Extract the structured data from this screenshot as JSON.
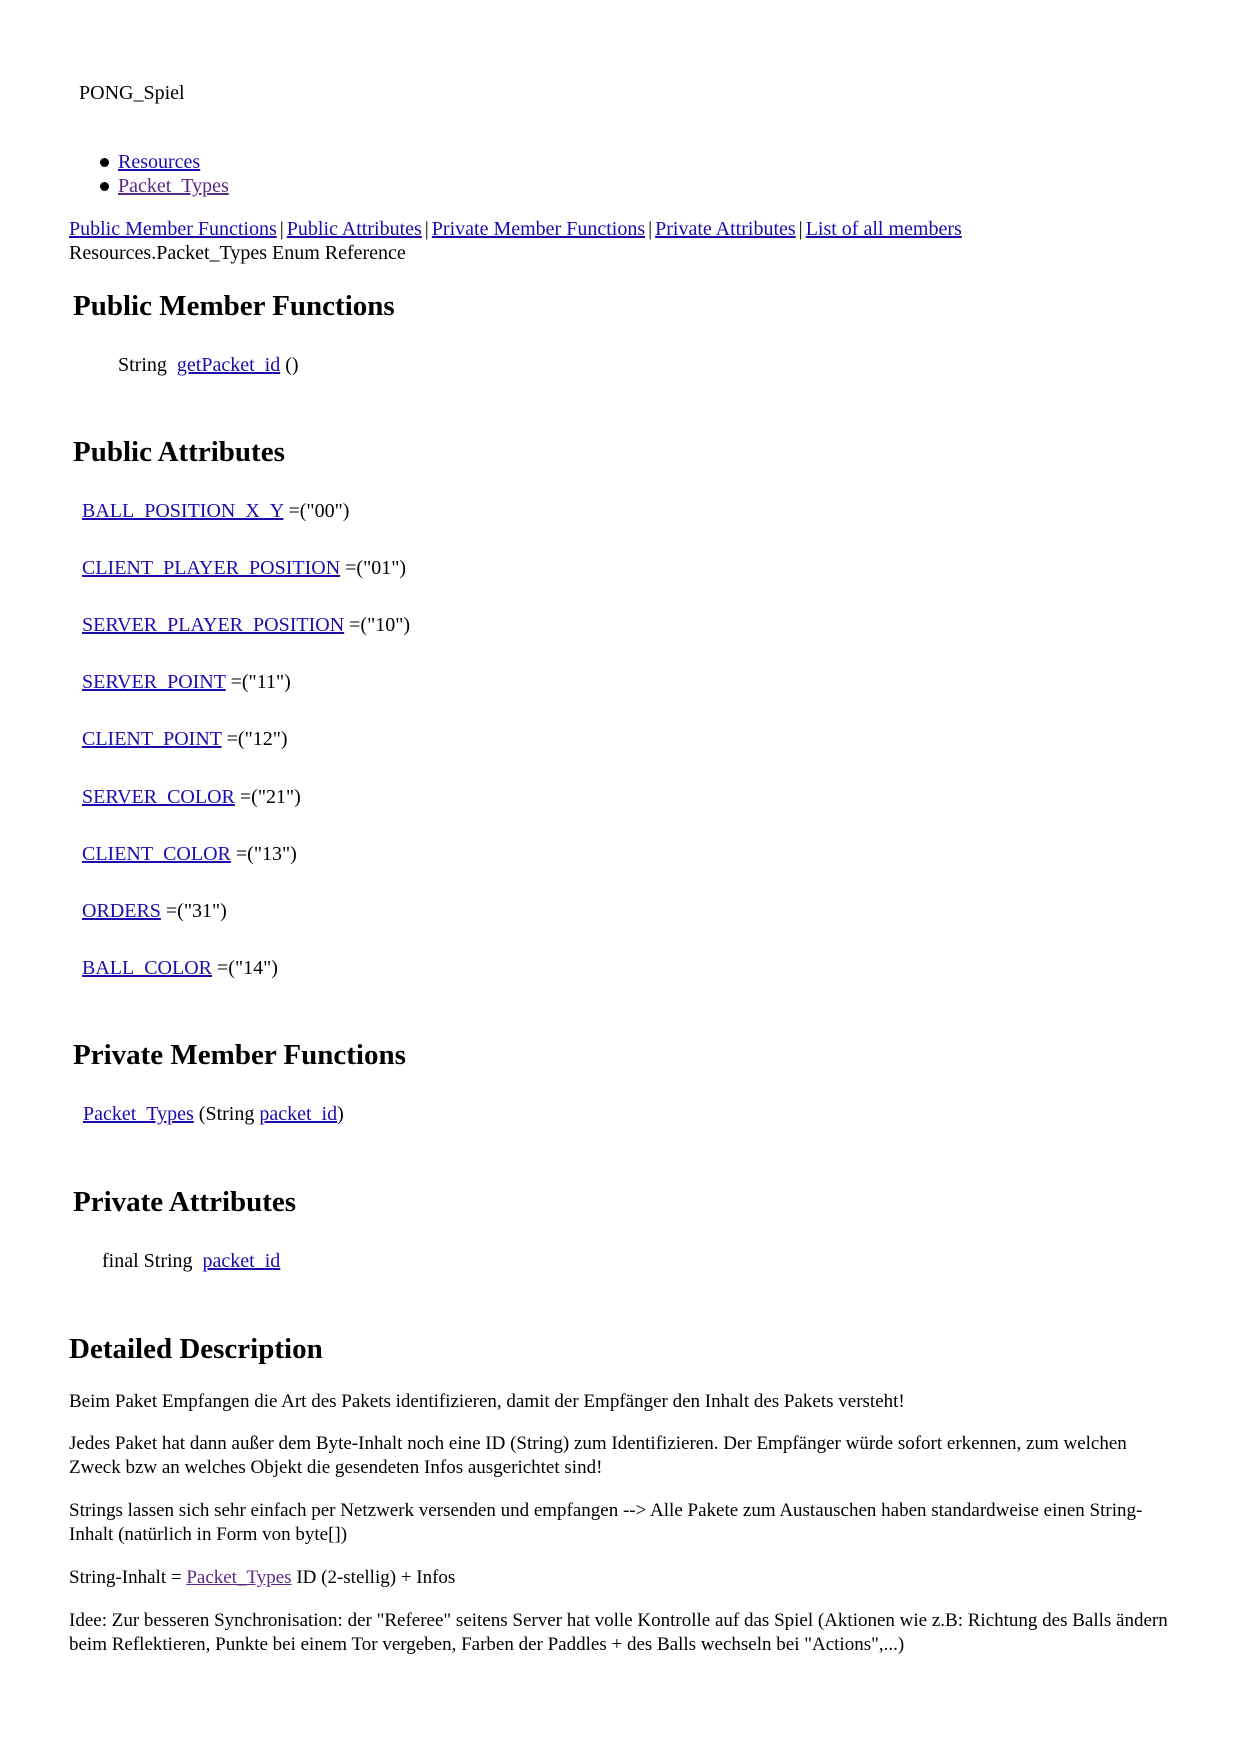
{
  "project": {
    "title": "PONG_Spiel"
  },
  "nav": {
    "items": [
      {
        "label": "Resources"
      },
      {
        "label": "Packet_Types"
      }
    ]
  },
  "summary": {
    "links": [
      "Public Member Functions",
      "Public Attributes",
      "Private Member Functions",
      "Private Attributes",
      "List of all members"
    ],
    "separator": "|"
  },
  "page": {
    "title": "Resources.Packet_Types Enum Reference"
  },
  "public_member_functions": {
    "heading": "Public Member Functions",
    "items": [
      {
        "type": "String",
        "name": "getPacket_id",
        "suffix": " ()"
      }
    ]
  },
  "public_attributes": {
    "heading": "Public Attributes",
    "items": [
      {
        "name": "BALL_POSITION_X_Y",
        "value": " =(\"00\")"
      },
      {
        "name": "CLIENT_PLAYER_POSITION",
        "value": " =(\"01\")"
      },
      {
        "name": "SERVER_PLAYER_POSITION",
        "value": " =(\"10\")"
      },
      {
        "name": "SERVER_POINT",
        "value": " =(\"11\")"
      },
      {
        "name": "CLIENT_POINT",
        "value": " =(\"12\")"
      },
      {
        "name": "SERVER_COLOR",
        "value": " =(\"21\")"
      },
      {
        "name": "CLIENT_COLOR",
        "value": " =(\"13\")"
      },
      {
        "name": "ORDERS",
        "value": " =(\"31\")"
      },
      {
        "name": "BALL_COLOR",
        "value": " =(\"14\")"
      }
    ]
  },
  "private_member_functions": {
    "heading": "Private Member Functions",
    "items": [
      {
        "name": "Packet_Types",
        "params_prefix": " (String ",
        "param": "packet_id",
        "params_suffix": ")"
      }
    ]
  },
  "private_attributes": {
    "heading": "Private Attributes",
    "items": [
      {
        "type": "final String",
        "name": "packet_id"
      }
    ]
  },
  "detailed_description": {
    "heading": "Detailed Description",
    "p1": "Beim Paket Empfangen die Art des Pakets identifizieren, damit der Empfänger den Inhalt des Pakets versteht!",
    "p2": "Jedes Paket hat dann außer dem Byte-Inhalt noch eine ID (String) zum Identifizieren. Der Empfänger würde sofort erkennen, zum welchen Zweck bzw an welches Objekt die gesendeten Infos ausgerichtet sind!",
    "p3": "Strings lassen sich sehr einfach per Netzwerk versenden und empfangen --> Alle Pakete zum Austauschen haben standardweise einen String-Inhalt (natürlich in Form von byte[])",
    "p4_prefix": "String-Inhalt = ",
    "p4_link": "Packet_Types",
    "p4_suffix": " ID (2-stellig) + Infos",
    "p5": "Idee: Zur besseren Synchronisation: der \"Referee\" seitens Server hat volle Kontrolle auf das Spiel (Aktionen wie z.B: Richtung des Balls ändern beim Reflektieren, Punkte bei einem Tor vergeben, Farben der Paddles + des Balls wechseln bei \"Actions\",...)"
  },
  "colors": {
    "link": "#1a0dab",
    "visited_link": "#5a2a82",
    "text": "#000000",
    "background": "#ffffff"
  }
}
